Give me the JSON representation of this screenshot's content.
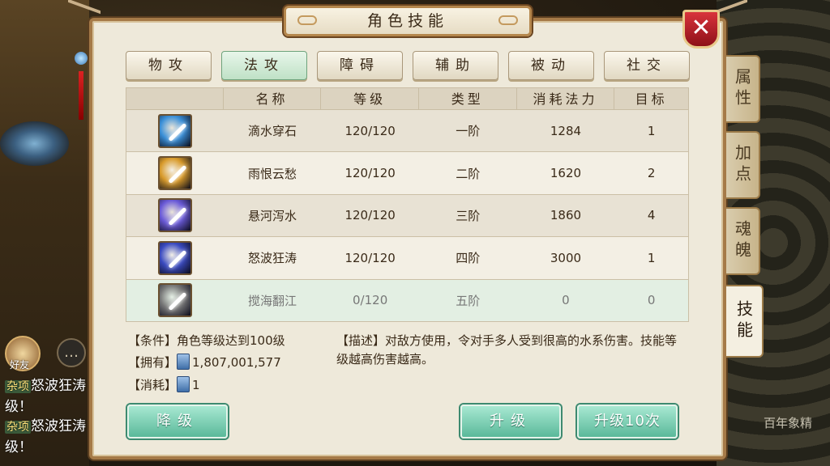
{
  "title": "角色技能",
  "close_label": "✕",
  "category_tabs": [
    {
      "label": "物攻"
    },
    {
      "label": "法攻",
      "active": true
    },
    {
      "label": "障碍"
    },
    {
      "label": "辅助"
    },
    {
      "label": "被动"
    },
    {
      "label": "社交"
    }
  ],
  "side_tabs": [
    {
      "label": "属性"
    },
    {
      "label": "加点"
    },
    {
      "label": "魂魄"
    },
    {
      "label": "技能",
      "active": true
    }
  ],
  "table": {
    "headers": [
      "",
      "名称",
      "等级",
      "类型",
      "消耗法力",
      "目标"
    ],
    "rows": [
      {
        "name": "滴水穿石",
        "level": "120/120",
        "type": "一阶",
        "cost": "1284",
        "target": "1",
        "icon": "blade-icon",
        "color": "#3a8fd8"
      },
      {
        "name": "雨恨云愁",
        "level": "120/120",
        "type": "二阶",
        "cost": "1620",
        "target": "2",
        "icon": "sparkle-sword-icon",
        "color": "#d89a2a"
      },
      {
        "name": "悬河泻水",
        "level": "120/120",
        "type": "三阶",
        "cost": "1860",
        "target": "4",
        "icon": "triple-blade-icon",
        "color": "#6a5ad8"
      },
      {
        "name": "怒波狂涛",
        "level": "120/120",
        "type": "四阶",
        "cost": "3000",
        "target": "1",
        "icon": "vortex-blade-icon",
        "color": "#3a4ac0"
      },
      {
        "name": "搅海翻江",
        "level": "0/120",
        "type": "五阶",
        "cost": "0",
        "target": "0",
        "icon": "grey-blade-icon",
        "color": "#777777"
      }
    ]
  },
  "info": {
    "condition": "【条件】角色等级达到100级",
    "owned_label": "【拥有】",
    "owned_value": "1,807,001,577",
    "consume_label": "【消耗】",
    "consume_value": "1",
    "description": "【描述】对敌方使用，令对手多人受到很高的水系伤害。技能等级越高伤害越高。"
  },
  "buttons": {
    "downgrade": "降级",
    "upgrade": "升级",
    "upgrade10": "升级10次"
  },
  "background": {
    "friend_label": "好友",
    "chat_tag": "杂项",
    "chat_line1": "怒波狂涛",
    "chat_line1_b": "级！",
    "chat_line2": "怒波狂涛",
    "chat_line2_b": "级！",
    "npc_name": "百年象精"
  }
}
